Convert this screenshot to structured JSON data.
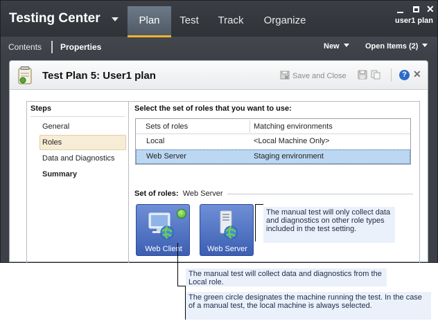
{
  "app": {
    "title": "Testing Center",
    "user": "user1 plan",
    "hub_tabs": [
      {
        "label": "Plan",
        "active": true
      },
      {
        "label": "Test",
        "active": false
      },
      {
        "label": "Track",
        "active": false
      },
      {
        "label": "Organize",
        "active": false
      }
    ],
    "subnav": {
      "contents": "Contents",
      "properties": "Properties",
      "new": "New",
      "open_items": "Open Items (2)"
    }
  },
  "panel": {
    "title": "Test Plan 5: User1 plan",
    "save_and_close": "Save and Close",
    "help": "?"
  },
  "steps": {
    "title": "Steps",
    "items": [
      {
        "label": "General",
        "selected": false,
        "bold": false
      },
      {
        "label": "Roles",
        "selected": true,
        "bold": false
      },
      {
        "label": "Data and Diagnostics",
        "selected": false,
        "bold": false
      },
      {
        "label": "Summary",
        "selected": false,
        "bold": true
      }
    ]
  },
  "roles": {
    "instruction": "Select the set of roles that you want to use:",
    "columns": [
      "Sets of roles",
      "Matching environments"
    ],
    "rows": [
      {
        "role": "Local",
        "environment": "<Local Machine Only>",
        "selected": false
      },
      {
        "role": "Web Server",
        "environment": "Staging environment",
        "selected": true
      }
    ],
    "set_of_roles_label": "Set of roles:",
    "set_of_roles_value": "Web Server",
    "tiles": [
      {
        "label": "Web Client",
        "icon": "web-client-icon",
        "running": true
      },
      {
        "label": "Web Server",
        "icon": "web-server-icon",
        "running": false
      }
    ]
  },
  "callouts": {
    "server": "The manual test will only collect data and diagnostics on other role types included in the test setting.",
    "client": "The manual test will collect data and diagnostics from the Local role.",
    "green_circle": "The green circle designates the machine running the test. In the case of a manual test, the local machine is always selected."
  },
  "colors": {
    "accent_tab_underline": "#f0b428",
    "selected_row": "#bcd7f2",
    "tile_blue": "#3c5fb3",
    "callout_bg": "#ebf1fb"
  }
}
